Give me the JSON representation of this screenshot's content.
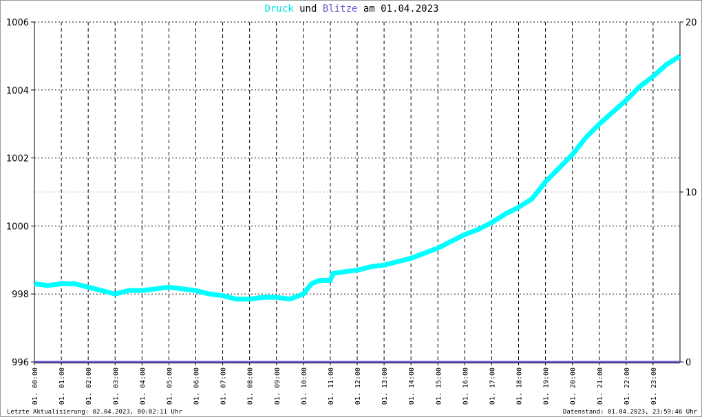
{
  "chart_data": {
    "type": "line",
    "title_parts": {
      "series1": "Druck",
      "mid": "und",
      "series2": "Blitze",
      "suffix": "am 01.04.2023"
    },
    "colors": {
      "druck": "#00ffff",
      "blitze": "#6a5acd"
    },
    "y_left": {
      "min": 996,
      "max": 1006,
      "ticks": [
        "1006",
        "1004",
        "1002",
        "1000",
        "998",
        "996"
      ]
    },
    "y_right": {
      "min": 0,
      "max": 20,
      "ticks": [
        "20",
        "10",
        "0"
      ]
    },
    "x_ticks": [
      "01. 00:00",
      "01. 01:00",
      "01. 02:00",
      "01. 03:00",
      "01. 04:00",
      "01. 05:00",
      "01. 06:00",
      "01. 07:00",
      "01. 08:00",
      "01. 09:00",
      "01. 10:00",
      "01. 11:00",
      "01. 12:00",
      "01. 13:00",
      "01. 14:00",
      "01. 15:00",
      "01. 16:00",
      "01. 17:00",
      "01. 18:00",
      "01. 19:00",
      "01. 20:00",
      "01. 21:00",
      "01. 22:00",
      "01. 23:00"
    ],
    "series": [
      {
        "name": "Druck",
        "x_hours": [
          0,
          0.5,
          1,
          1.5,
          2,
          2.5,
          3,
          3.5,
          4,
          4.5,
          5,
          5.5,
          6,
          6.5,
          7,
          7.5,
          8,
          8.5,
          9,
          9.5,
          10,
          10.3,
          10.6,
          11,
          11.1,
          11.5,
          12,
          12.5,
          13,
          13.5,
          14,
          14.5,
          15,
          15.5,
          16,
          16.5,
          17,
          17.5,
          18,
          18.5,
          19,
          19.5,
          20,
          20.5,
          21,
          21.5,
          22,
          22.5,
          23,
          23.5,
          24
        ],
        "values": [
          998.3,
          998.25,
          998.3,
          998.3,
          998.2,
          998.1,
          998.0,
          998.1,
          998.1,
          998.15,
          998.2,
          998.15,
          998.1,
          998.0,
          997.95,
          997.85,
          997.85,
          997.9,
          997.9,
          997.85,
          998.0,
          998.3,
          998.4,
          998.4,
          998.6,
          998.65,
          998.7,
          998.8,
          998.85,
          998.95,
          999.05,
          999.2,
          999.35,
          999.55,
          999.75,
          999.9,
          1000.1,
          1000.35,
          1000.55,
          1000.8,
          1001.3,
          1001.7,
          1002.1,
          1002.6,
          1003.0,
          1003.35,
          1003.7,
          1004.1,
          1004.4,
          1004.75,
          1005.0
        ]
      },
      {
        "name": "Blitze",
        "x_hours": [
          0,
          24
        ],
        "values": [
          0,
          0
        ]
      }
    ]
  },
  "footer": {
    "left": "Letzte Aktualisierung: 02.04.2023, 00:02:11 Uhr",
    "right": "Datenstand: 01.04.2023, 23:59:46 Uhr"
  }
}
